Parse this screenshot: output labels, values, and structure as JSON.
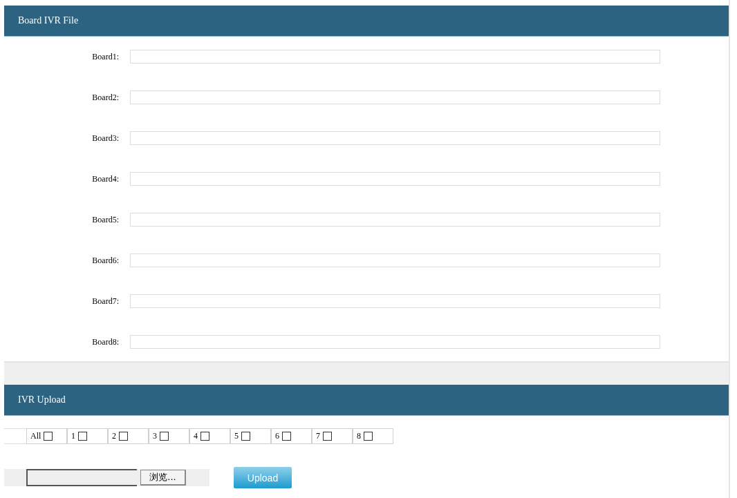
{
  "board_ivr_file": {
    "title": "Board IVR File",
    "boards": [
      {
        "label": "Board1:"
      },
      {
        "label": "Board2:"
      },
      {
        "label": "Board3:"
      },
      {
        "label": "Board4:"
      },
      {
        "label": "Board5:"
      },
      {
        "label": "Board6:"
      },
      {
        "label": "Board7:"
      },
      {
        "label": "Board8:"
      }
    ]
  },
  "ivr_upload": {
    "title": "IVR Upload",
    "targets": [
      {
        "label": "All",
        "checked": false
      },
      {
        "label": "1",
        "checked": false
      },
      {
        "label": "2",
        "checked": false
      },
      {
        "label": "3",
        "checked": false
      },
      {
        "label": "4",
        "checked": false
      },
      {
        "label": "5",
        "checked": false
      },
      {
        "label": "6",
        "checked": false
      },
      {
        "label": "7",
        "checked": false
      },
      {
        "label": "8",
        "checked": false
      }
    ],
    "browse_button": "浏览...",
    "upload_button": "Upload"
  }
}
